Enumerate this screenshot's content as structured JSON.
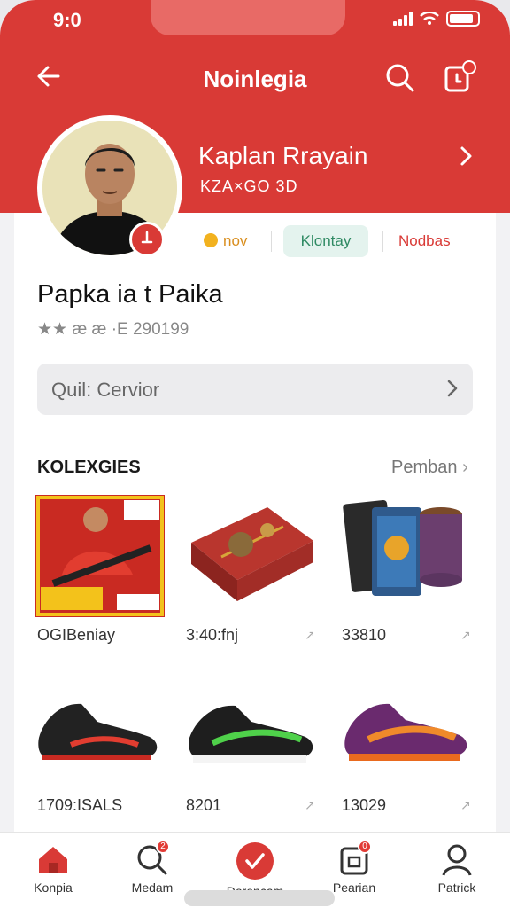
{
  "status": {
    "time": "9:0"
  },
  "nav": {
    "title": "Noinlegia"
  },
  "profile": {
    "name": "Kaplan Rrayain",
    "sub": "KZA×GO 3D",
    "tags": [
      "nov",
      "Klontay",
      "Nodbas"
    ]
  },
  "shop": {
    "name": "Papka ia t Paika",
    "rating": "★★ æ æ ·E 290199"
  },
  "quick": {
    "label": "Quil: Cervior"
  },
  "section": {
    "title": "KOLEXGIES",
    "more": "Pemban"
  },
  "products": [
    {
      "price": "OGIBeniay",
      "kind": "poster"
    },
    {
      "price": "3:40:fnj",
      "kind": "box"
    },
    {
      "price": "33810",
      "kind": "cards"
    },
    {
      "price": "1709:ISALS",
      "kind": "shoe-black-red"
    },
    {
      "price": "8201",
      "kind": "shoe-black-green"
    },
    {
      "price": "13029",
      "kind": "shoe-purple-orange"
    }
  ],
  "tabs": [
    {
      "label": "Konpia",
      "icon": "home-icon",
      "badge": ""
    },
    {
      "label": "Medam",
      "icon": "search-icon",
      "badge": "2"
    },
    {
      "label": "Doroncam",
      "icon": "check-circle-icon",
      "badge": ""
    },
    {
      "label": "Pearian",
      "icon": "bag-icon",
      "badge": "0"
    },
    {
      "label": "Patrick",
      "icon": "user-icon",
      "badge": ""
    }
  ],
  "colors": {
    "accent": "#d93a36",
    "accent_light": "#e4f3ee",
    "green": "#2f8a63"
  }
}
